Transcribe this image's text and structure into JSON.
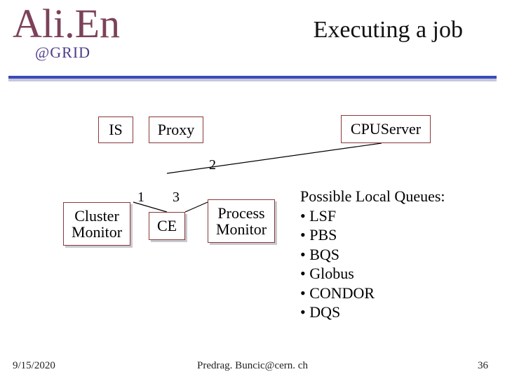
{
  "header": {
    "logo": "Ali.En",
    "logo_sub": "@GRID",
    "title": "Executing a  job"
  },
  "boxes": {
    "is": "IS",
    "proxy": "Proxy",
    "cpu": "CPUServer",
    "cluster_l1": "Cluster",
    "cluster_l2": "Monitor",
    "ce": "CE",
    "process_l1": "Process",
    "process_l2": "Monitor"
  },
  "numbers": {
    "n1": "1",
    "n2": "2",
    "n3": "3"
  },
  "notes": {
    "heading": "Possible Local Queues:",
    "items": [
      "LSF",
      "PBS",
      "BQS",
      "Globus",
      "CONDOR",
      "DQS"
    ]
  },
  "footer": {
    "date": "9/15/2020",
    "author": "Predrag. Buncic@cern. ch",
    "page": "36"
  }
}
